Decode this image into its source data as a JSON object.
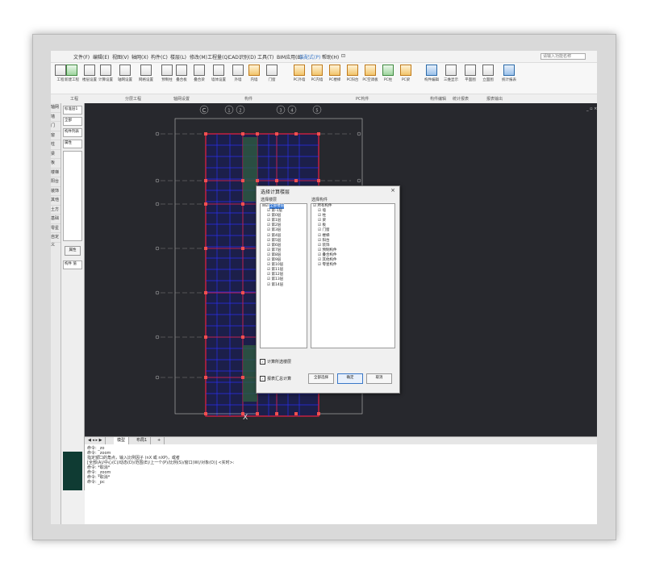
{
  "menu": [
    {
      "label": "文件(F)"
    },
    {
      "label": "编辑(E)"
    },
    {
      "label": "视图(V)"
    },
    {
      "label": "轴网(X)"
    },
    {
      "label": "构件(C)"
    },
    {
      "label": "楼层(L)"
    },
    {
      "label": "修改(M)"
    },
    {
      "label": "工程量(Q)"
    },
    {
      "label": "CAD识别(D)"
    },
    {
      "label": "工具(T)"
    },
    {
      "label": "BIM应用(B)"
    },
    {
      "label": "装配式(P)",
      "active": true
    },
    {
      "label": "帮助(H)"
    },
    {
      "label": "⊡"
    }
  ],
  "search_placeholder": "请输入功能名称",
  "ribbon": [
    {
      "label": "工程",
      "c": ""
    },
    {
      "label": "新建工程",
      "c": "g"
    },
    {
      "label": "楼层设置",
      "c": ""
    },
    {
      "label": "计算设置",
      "c": ""
    },
    {
      "label": "轴网设置",
      "c": ""
    },
    {
      "label": "网格设置",
      "c": ""
    },
    {
      "label": "预制柱",
      "c": ""
    },
    {
      "label": "叠合板",
      "c": ""
    },
    {
      "label": "叠合梁",
      "c": ""
    },
    {
      "label": "墙体设置",
      "c": ""
    },
    {
      "label": "外墙",
      "c": ""
    },
    {
      "label": "内墙",
      "c": "o"
    },
    {
      "label": "门窗",
      "c": ""
    },
    {
      "label": "PC外墙",
      "c": "o"
    },
    {
      "label": "PC内墙",
      "c": "o"
    },
    {
      "label": "PC楼梯",
      "c": "o"
    },
    {
      "label": "PC阳台",
      "c": "o"
    },
    {
      "label": "PC空调板",
      "c": "o"
    },
    {
      "label": "PC柱",
      "c": "g"
    },
    {
      "label": "PC梁",
      "c": "o"
    },
    {
      "label": "构件编辑",
      "c": "b"
    },
    {
      "label": "三维显示",
      "c": ""
    },
    {
      "label": "平面图",
      "c": ""
    },
    {
      "label": "立面图",
      "c": ""
    },
    {
      "label": "统计报表",
      "c": "b"
    }
  ],
  "groups": [
    "工程",
    "分层工程",
    "轴网设置",
    "构件",
    "PC构件",
    "构件编辑",
    "统计报表",
    "报表输出"
  ],
  "leftbar": [
    "轴网",
    "墙",
    "门",
    "窗",
    "柱",
    "梁",
    "板",
    "楼梯",
    "阳台",
    "装饰",
    "其他",
    "土方",
    "基础",
    "零星",
    "自定义"
  ],
  "panel": {
    "fields": [
      "标准层1",
      "全部",
      "构件列表",
      "属性"
    ],
    "button": "属性",
    "extra": "构件 值"
  },
  "canvas": {
    "axis_top": [
      "C",
      "1",
      "2",
      "3",
      "4",
      "5"
    ]
  },
  "dialog": {
    "title": "选择计算楼层",
    "left_label": "选择楼层",
    "right_label": "选择构件",
    "floors": [
      "全部楼层",
      "第-1层",
      "第0层",
      "第1层",
      "第2层",
      "第3层",
      "第4层",
      "第5层",
      "第6层",
      "第7层",
      "第8层",
      "第9层",
      "第10层",
      "第11层",
      "第12层",
      "第13层",
      "第14层"
    ],
    "components": [
      "☑ 所有构件",
      "☑ 墙",
      "☑ 柱",
      "☑ 梁",
      "☑ 板",
      "☑ 门窗",
      "☑ 楼梯",
      "☑ 阳台",
      "☑ 装饰",
      "☑ 预制构件",
      "☑ 叠合构件",
      "☑ 其他构件",
      "☑ 零星构件"
    ],
    "check1": "计算所选楼层",
    "check2": "报表汇总计算",
    "btn_select": "全部选择",
    "btn_ok": "确定",
    "btn_cancel": "取消"
  },
  "tabs": [
    "模型",
    "布局1",
    "+"
  ],
  "cmd_lines": [
    "命令: _zo",
    "命令: _zoom",
    "指定窗口的角点，输入比例因子 (nX 或 nXP)，或者",
    "[全部(A)/中心(C)/动态(D)/范围(E)/上一个(P)/比例(S)/窗口(W)/对象(O)] <实时>:",
    "命令: *取消*",
    "命令: _zoom",
    "命令: *取消*",
    "命令: _pc"
  ]
}
